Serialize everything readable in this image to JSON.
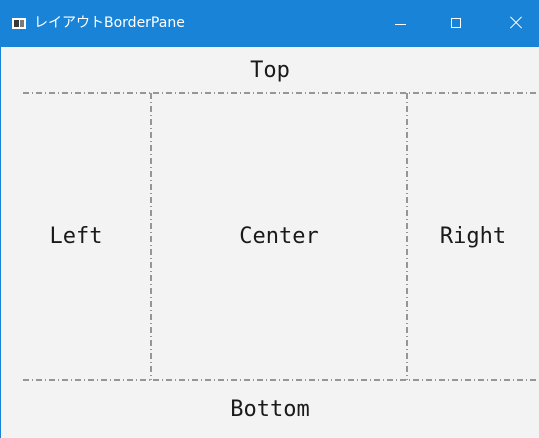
{
  "window": {
    "title": "レイアウトBorderPane",
    "controls": {
      "minimize_icon": "minimize-icon",
      "maximize_icon": "maximize-icon",
      "close_icon": "close-icon"
    }
  },
  "border_pane": {
    "top": "Top",
    "left": "Left",
    "center": "Center",
    "right": "Right",
    "bottom": "Bottom"
  },
  "colors": {
    "titlebar": "#1883d7",
    "background": "#f3f3f3",
    "text": "#1a1a1a",
    "divider": "#3a3a3a"
  }
}
